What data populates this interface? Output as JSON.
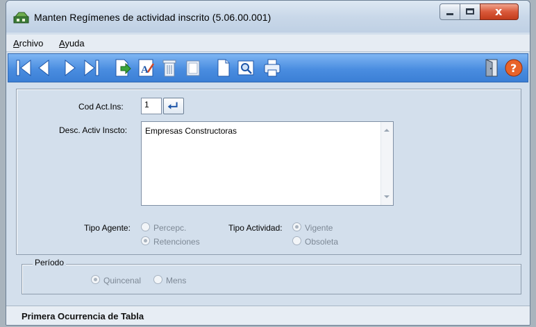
{
  "window": {
    "title": "Manten  Regímenes de actividad inscrito (5.06.00.001)"
  },
  "menu": {
    "items": [
      {
        "first": "A",
        "rest": "rchivo"
      },
      {
        "first": "A",
        "rest": "yuda"
      }
    ]
  },
  "toolbar": {
    "buttons": [
      "first-record",
      "previous-record",
      "next-record",
      "last-record",
      "insert",
      "edit",
      "delete",
      "new-document",
      "preview",
      "print",
      "exit",
      "help"
    ]
  },
  "form": {
    "cod_label": "Cod Act.Ins:",
    "cod_value": "1",
    "desc_label": "Desc. Activ Inscto:",
    "desc_value": "Empresas Constructoras",
    "tipo_agente_label": "Tipo Agente:",
    "tipo_agente_options": [
      "Percepc.",
      "Retenciones"
    ],
    "tipo_agente_selected": "Retenciones",
    "tipo_actividad_label": "Tipo Actividad:",
    "tipo_actividad_options": [
      "Vigente",
      "Obsoleta"
    ],
    "tipo_actividad_selected": "Vigente"
  },
  "periodo": {
    "title": "Período",
    "options": [
      "Quincenal",
      "Mens"
    ],
    "selected": "Quincenal"
  },
  "status": {
    "text": "Primera Ocurrencia de Tabla"
  },
  "colors": {
    "toolbar": "#4a8de0",
    "window_bg": "#d3dfec",
    "close_button": "#d9593a",
    "help_icon": "#e8632a"
  }
}
